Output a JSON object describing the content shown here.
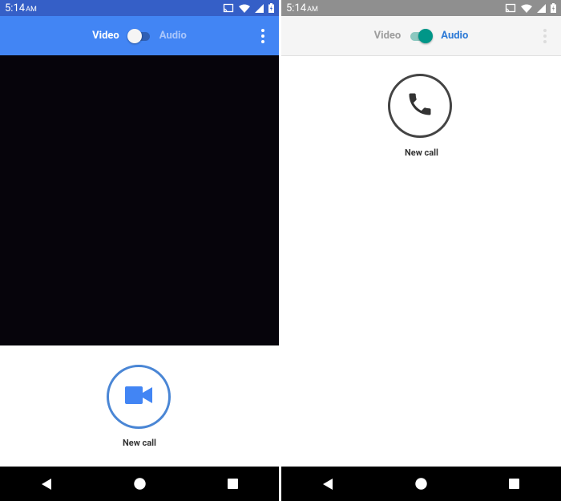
{
  "left_screen": {
    "status": {
      "time": "5:14",
      "ampm": "AM"
    },
    "appbar": {
      "video_label": "Video",
      "audio_label": "Audio",
      "mode": "video",
      "menu_icon": "more-vert-icon"
    },
    "call_button": {
      "icon": "videocam-icon",
      "label": "New call"
    },
    "navbar": {
      "back_icon": "back-icon",
      "home_icon": "home-icon",
      "recents_icon": "recents-icon"
    }
  },
  "right_screen": {
    "status": {
      "time": "5:14",
      "ampm": "AM"
    },
    "appbar": {
      "video_label": "Video",
      "audio_label": "Audio",
      "mode": "audio",
      "menu_icon": "more-vert-icon"
    },
    "call_button": {
      "icon": "phone-icon",
      "label": "New call"
    },
    "navbar": {
      "back_icon": "back-icon",
      "home_icon": "home-icon",
      "recents_icon": "recents-icon"
    }
  },
  "colors": {
    "left_status_bar": "#355fc7",
    "left_app_bar": "#4285f4",
    "right_status_bar": "#8f8f8f",
    "right_app_bar": "#f5f5f5",
    "video_area": "#06040b",
    "video_accent": "#4a86d5",
    "audio_toggle": "#009688",
    "audio_label": "#2f7bd6",
    "nav_bar": "#000000"
  }
}
